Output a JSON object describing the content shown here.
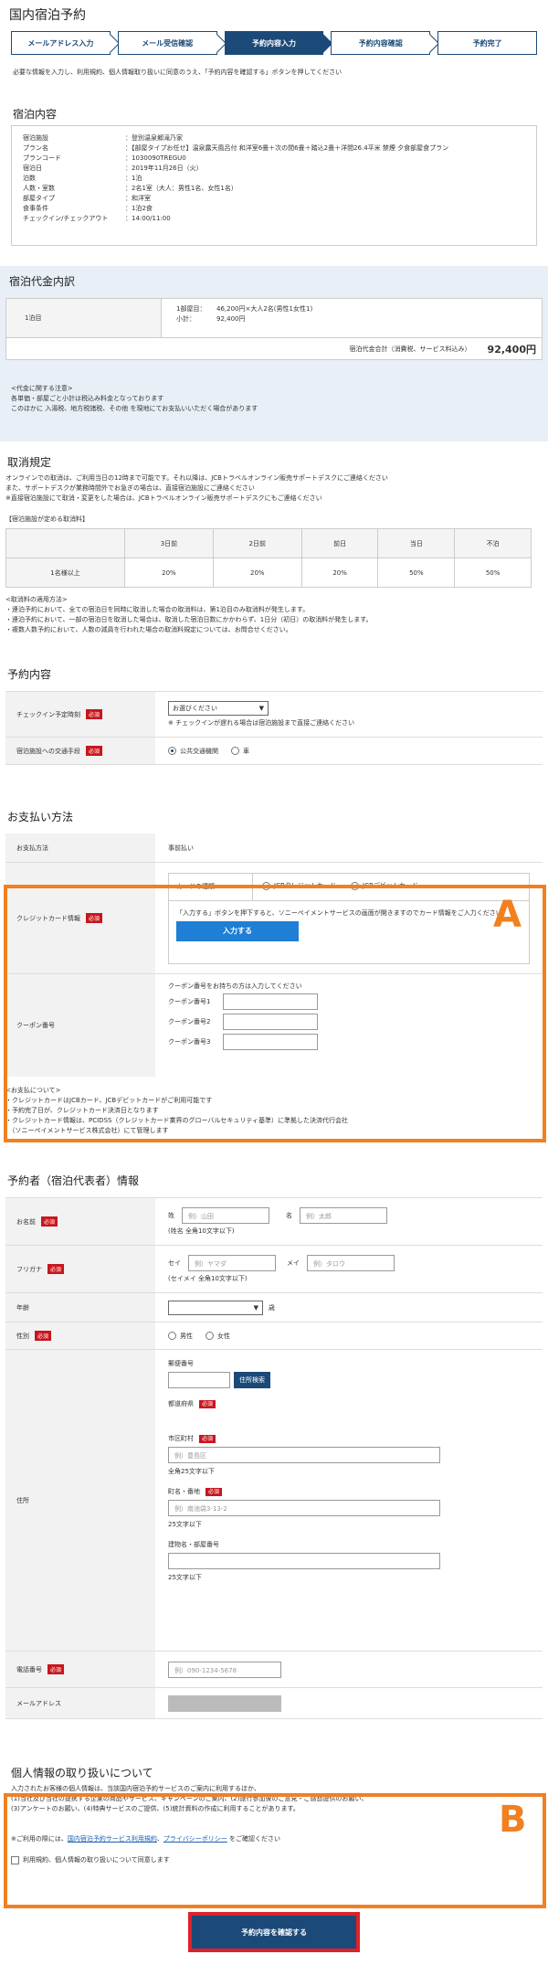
{
  "page": {
    "title": "国内宿泊予約"
  },
  "steps": [
    "メールアドレス入力",
    "メール受信確認",
    "予約内容入力",
    "予約内容確認",
    "予約完了"
  ],
  "intro": "必要な情報を入力し、利用規約、個人情報取り扱いに同意のうえ、「予約内容を確認する」ボタンを押してください",
  "stay": {
    "heading": "宿泊内容",
    "rows": [
      {
        "k": "宿泊施設",
        "v": "：登別温泉郷滝乃家"
      },
      {
        "k": "プラン名",
        "v": "：【部屋タイプお任せ】温泉露天風呂付 和洋室6畳＋次の間6畳＋踏込2畳＋洋間26.4平米 禁煙 夕食部屋食プラン"
      },
      {
        "k": "プランコード",
        "v": "：1030090TREGU0"
      },
      {
        "k": "宿泊日",
        "v": "：2019年11月26日（火）"
      },
      {
        "k": "泊数",
        "v": "：1泊"
      },
      {
        "k": "人数・室数",
        "v": "：2名1室（大人：男性1名、女性1名）"
      },
      {
        "k": "部屋タイプ",
        "v": "：和洋室"
      },
      {
        "k": "食事条件",
        "v": "：1泊2食"
      },
      {
        "k": "チェックイン/チェックアウト",
        "v": "：14:00/11:00"
      }
    ]
  },
  "price": {
    "heading": "宿泊代金内訳",
    "night_label": "1泊目",
    "line1_k": "1部屋目：",
    "line1_v": "46,200円×大人2名(男性1女性1)",
    "line2_k": "小計：",
    "line2_v": "92,400円",
    "total_label": "宿泊代金合計（消費税、サービス料込み）",
    "total_value": "92,400円"
  },
  "price_notes": [
    "<代金に関する注意>",
    "各単価・部屋ごと小計は税込み料金となっております",
    "このほかに 入湯税、地方税諸税、その他 を現地にてお支払いいただく場合があります"
  ],
  "cancel": {
    "heading": "取消規定",
    "lines": [
      "オンラインでの取消は、ご利用当日の12時まで可能です。それ以降は、JCBトラベルオンライン販売サポートデスクにご連絡ください",
      "また、サポートデスクが業務時間外でお急ぎの場合は、直接宿泊施設にご連絡ください",
      "※直接宿泊施設にて取消・変更をした場合は、JCBトラベルオンライン販売サポートデスクにもご連絡ください"
    ],
    "table_caption": "【宿泊施設が定める取消料】",
    "headers": [
      "",
      "3日前",
      "2日前",
      "前日",
      "当日",
      "不泊"
    ],
    "row_label": "1名様以上",
    "values": [
      "20%",
      "20%",
      "20%",
      "50%",
      "50%"
    ],
    "rules": [
      "<取消料の適用方法>",
      "・連泊予約において、全ての宿泊日を同時に取消した場合の取消料は、第1泊目のみ取消料が発生します。",
      "・連泊予約において、一部の宿泊日を取消した場合は、取消した宿泊日数にかかわらず、1日分（初日）の取消料が発生します。",
      "・複数人数予約において、人数の減員を行われた場合の取消料規定については、お問合せください。"
    ]
  },
  "reservation": {
    "heading": "予約内容",
    "checkin_label": "チェックイン予定時刻",
    "checkin_select": "お選びください",
    "checkin_note": "※ チェックインが遅れる場合は宿泊施設まで直接ご連絡ください",
    "transport_label": "宿泊施設への交通手段",
    "transport_opt1": "公共交通機関",
    "transport_opt2": "車"
  },
  "payment": {
    "heading": "お支払い方法",
    "method_label": "お支払方法",
    "method_value": "事前払い",
    "card_label": "クレジットカード情報",
    "card_type_label": "カードの種類",
    "card_opt1": "JCBクレジットカード",
    "card_opt2": "JCBデビットカード",
    "card_notice": "「入力する」ボタンを押下すると、ソニーペイメントサービスの画面が開きますのでカード情報をご入力ください",
    "input_button": "入力する",
    "coupon_label": "クーポン番号",
    "coupon_note": "クーポン番号をお持ちの方は入力してください",
    "coupon1": "クーポン番号1",
    "coupon2": "クーポン番号2",
    "coupon3": "クーポン番号3",
    "marker": "A",
    "notes": [
      "<お支払について>",
      "・クレジットカードはJCBカード、JCBデビットカードがご利用可能です",
      "・予約完了日が、クレジットカード決済日となります",
      "・クレジットカード情報は、PCIDSS（クレジットカード業界のグローバルセキュリティ基準）に準拠した決済代行会社",
      "　（ソニーペイメントサービス株式会社）にて管理します"
    ]
  },
  "rep": {
    "heading": "予約者（宿泊代表者）情報",
    "name_label": "お名前",
    "sei": "姓",
    "sei_ph": "例）山田",
    "mei": "名",
    "mei_ph": "例）太郎",
    "name_note": "(姓名 全角10文字以下)",
    "kana_label": "フリガナ",
    "sei_kana": "セイ",
    "sei_kana_ph": "例）ヤマダ",
    "mei_kana": "メイ",
    "mei_kana_ph": "例）タロウ",
    "kana_note": "(セイメイ 全角10文字以下)",
    "age_label": "年齢",
    "age_unit": "歳",
    "gender_label": "性別",
    "male": "男性",
    "female": "女性",
    "addr_label": "住所",
    "zip_label": "郵便番号",
    "zip_button": "住所検索",
    "pref_label": "都道府県",
    "city_label": "市区町村",
    "city_ph": "例）豊島区",
    "city_note": "全角25文字以下",
    "street_label": "町名・番地",
    "street_ph": "例）南池袋3-13-2",
    "street_note": "25文字以下",
    "bldg_label": "建物名・部屋番号",
    "bldg_note": "25文字以下",
    "phone_label": "電話番号",
    "phone_ph": "例）090-1234-5678",
    "email_label": "メールアドレス",
    "required": "必須"
  },
  "privacy": {
    "heading": "個人情報の取り扱いについて",
    "lines": [
      "入力されたお客様の個人情報は、当該国内宿泊予約サービスのご案内に利用するほか、",
      "(1)当社及び当社の提携する企業の商品やサービス、キャンペーンのご案内、(2)旅行参加後のご意見・ご感想提供のお願い、",
      "(3)アンケートのお願い、(4)特典サービスのご提供、(5)統計資料の作成に利用することがあります。"
    ],
    "usage_prefix": "※ご利用の際には、",
    "link1": "国内宿泊予約サービス利用規約",
    "sep": "、",
    "link2": "プライバシーポリシー",
    "usage_suffix": " をご確認ください",
    "agree": "利用規約、個人情報の取り扱いについて同意します",
    "marker": "B"
  },
  "submit": "予約内容を確認する",
  "colors": {
    "accent": "#1b4a78",
    "highlight": "#f08020",
    "required": "#c8161d",
    "submit_frame": "#e0202a"
  }
}
